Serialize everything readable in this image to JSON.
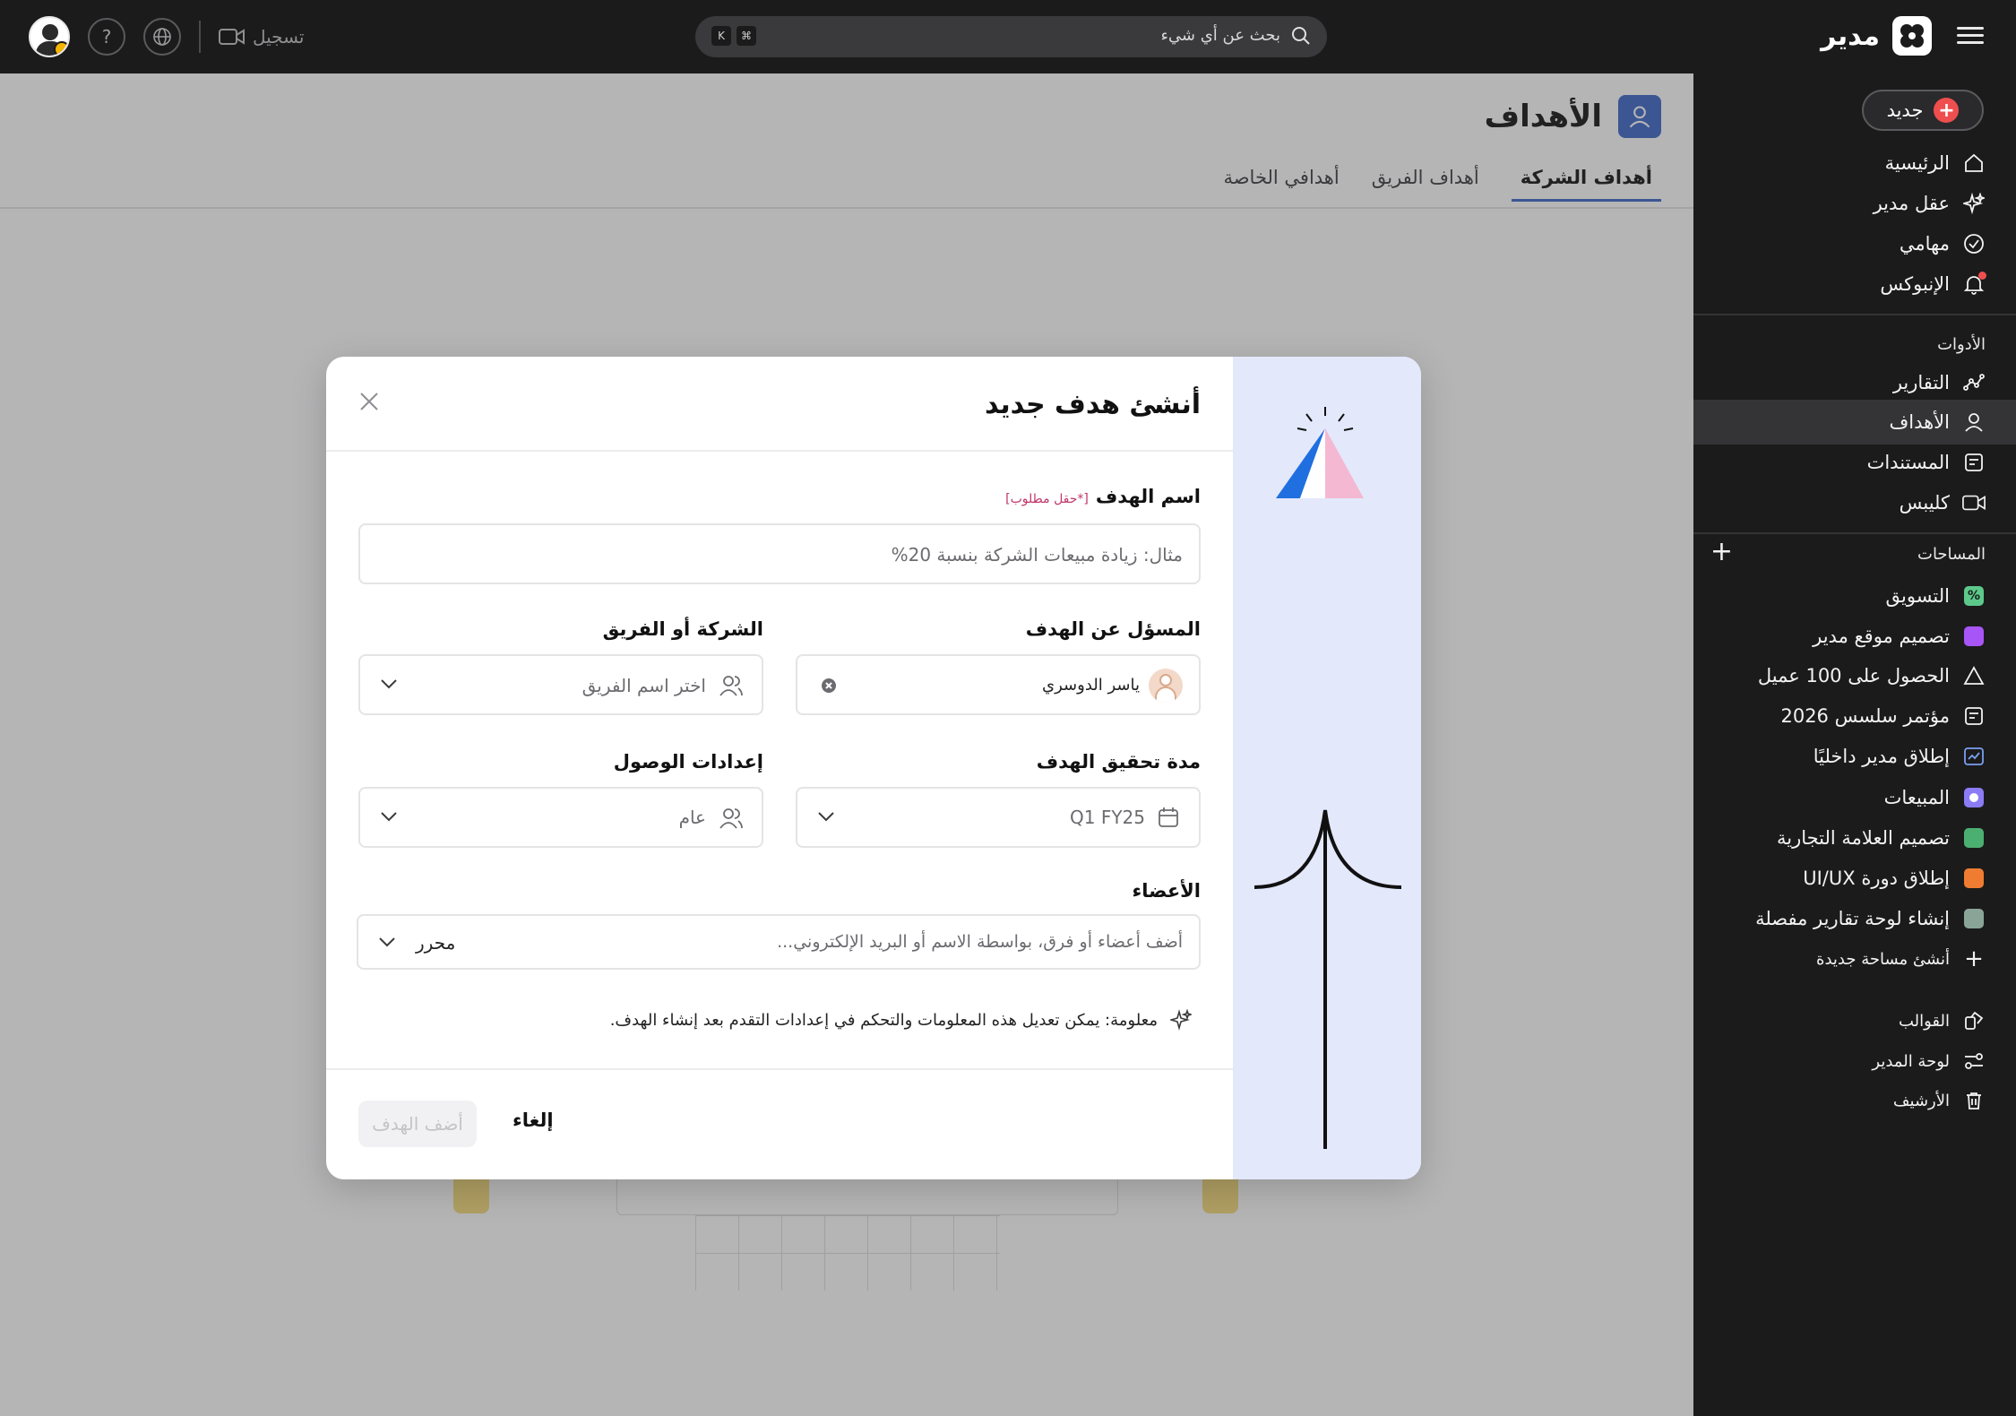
{
  "app": {
    "brand_name": "مدير",
    "search_placeholder": "بحث عن أي شيء",
    "shortcut_keys": [
      "⌘",
      "K"
    ],
    "record_label": "تسجيل",
    "help_glyph": "?"
  },
  "sidebar": {
    "new_label": "جديد",
    "main_items": [
      {
        "label": "الرئيسية",
        "icon": "home-icon"
      },
      {
        "label": "عقل مدير",
        "icon": "sparkle-icon"
      },
      {
        "label": "مهامي",
        "icon": "check-circle-icon"
      },
      {
        "label": "الإنبوكس",
        "icon": "bell-icon"
      }
    ],
    "tools_heading": "الأدوات",
    "tools": [
      {
        "label": "التقارير",
        "icon": "chart-line-icon"
      },
      {
        "label": "الأهداف",
        "icon": "goal-icon",
        "active": true
      },
      {
        "label": "المستندات",
        "icon": "document-icon"
      },
      {
        "label": "كليبس",
        "icon": "video-icon"
      }
    ],
    "spaces_heading": "المساحات",
    "spaces": [
      {
        "label": "التسويق",
        "color": "#5cc98a"
      },
      {
        "label": "تصميم موقع مدير",
        "color": "#a855f7"
      },
      {
        "label": "الحصول على 100 عميل",
        "icon": "triangle-icon"
      },
      {
        "label": "مؤتمر سلسس 2026",
        "icon": "document-icon"
      },
      {
        "label": "إطلاق مدير داخليًا",
        "icon": "chart-icon"
      },
      {
        "label": "المبيعات",
        "color": "#8b7cf6"
      },
      {
        "label": "تصميم العلامة التجارية",
        "color": "#4caf72"
      },
      {
        "label": "إطلاق دورة UI/UX",
        "color": "#f07c32"
      },
      {
        "label": "إنشاء لوحة تقارير مفصلة",
        "color": "#8aa597"
      }
    ],
    "create_space_label": "أنشئ مساحة جديدة",
    "footer_items": [
      {
        "label": "القوالب",
        "icon": "templates-icon"
      },
      {
        "label": "لوحة المدير",
        "icon": "admin-panel-icon"
      },
      {
        "label": "الأرشيف",
        "icon": "archive-icon"
      }
    ]
  },
  "page": {
    "title": "الأهداف",
    "tabs": [
      {
        "label": "أهداف الشركة",
        "active": true
      },
      {
        "label": "أهداف الفريق",
        "active": false
      },
      {
        "label": "أهدافي الخاصة",
        "active": false
      }
    ]
  },
  "modal": {
    "title": "أنشئ هدف جديد",
    "goal_name_label": "اسم الهدف",
    "required_note": "[*حقل مطلوب]",
    "goal_name_placeholder": "مثال: زيادة مبيعات الشركة بنسبة 20%",
    "owner_label": "المسؤل عن الهدف",
    "owner_value": "ياسر الدوسري",
    "team_label": "الشركة أو الفريق",
    "team_placeholder": "اختر اسم الفريق",
    "duration_label": "مدة تحقيق الهدف",
    "duration_value": "Q1 FY25",
    "access_label": "إعدادات الوصول",
    "access_value": "عام",
    "members_label": "الأعضاء",
    "members_placeholder": "أضف أعضاء أو فرق، بواسطة الاسم أو البريد الإلكتروني...",
    "members_role": "محرر",
    "info_text": "معلومة: يمكن تعديل هذه المعلومات والتحكم في إعدادات التقدم بعد إنشاء الهدف.",
    "cancel_label": "إلغاء",
    "submit_label": "أضف الهدف"
  },
  "colors": {
    "accent": "#3b66c5",
    "new_button_red": "#ef4e4e",
    "modal_side_bg": "#e3e8fb"
  }
}
